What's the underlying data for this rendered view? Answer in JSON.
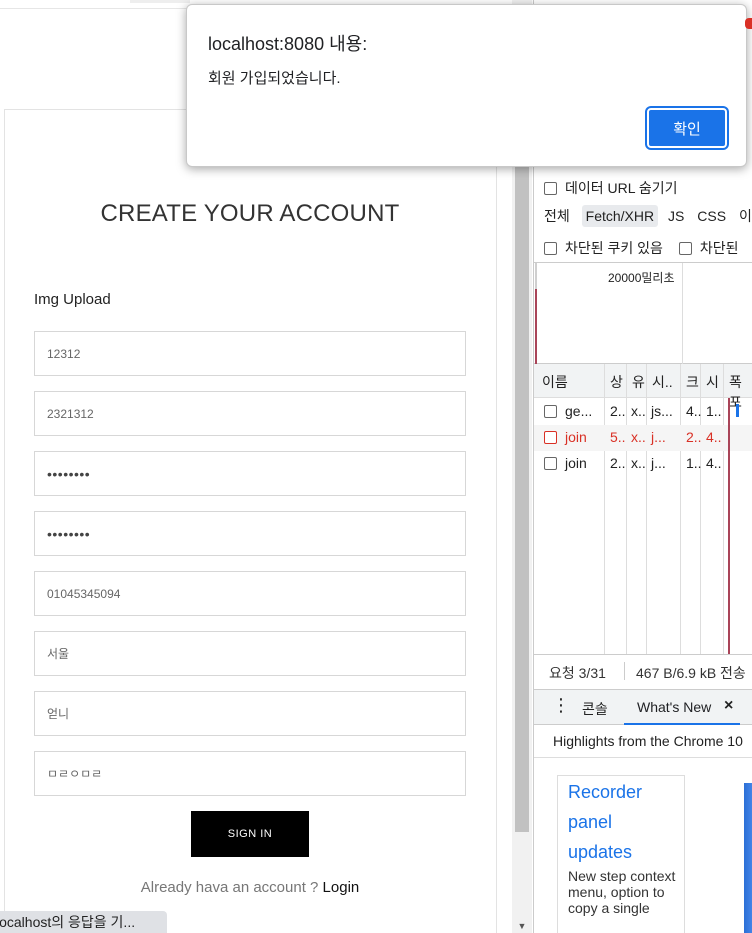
{
  "form": {
    "title": "CREATE YOUR ACCOUNT",
    "img_upload_label": "Img Upload",
    "fields": [
      {
        "value": "12312",
        "type": "text"
      },
      {
        "value": "2321312",
        "type": "text"
      },
      {
        "value": "••••••••",
        "type": "password"
      },
      {
        "value": "••••••••",
        "type": "password"
      },
      {
        "value": "01045345094",
        "type": "text"
      },
      {
        "value": "서울",
        "type": "text"
      },
      {
        "value": "얻니",
        "type": "text"
      },
      {
        "value": "ㅁㄹㅇㅁㄹ",
        "type": "text"
      }
    ],
    "signin_label": "SIGN IN",
    "already_text": "Already hava an account ? ",
    "login_label": "Login"
  },
  "statusbar": {
    "text": "localhost의 응답을 기..."
  },
  "alert": {
    "title": "localhost:8080 내용:",
    "message": "회원 가입되었습니다.",
    "ok_label": "확인"
  },
  "devtools": {
    "hide_data_url": "데이터 URL 숨기기",
    "filters": {
      "all": "전체",
      "fetch": "Fetch/XHR",
      "js": "JS",
      "css": "CSS",
      "more": "이"
    },
    "blocked_cookies": "차단된 쿠키 있음",
    "blocked_requests": "차단된",
    "timeline_label": "20000밀리초",
    "columns": [
      "이름",
      "상",
      "유",
      "시..",
      "크",
      "시",
      "폭포"
    ],
    "rows": [
      {
        "name": "ge...",
        "status": "2..",
        "type": "x..",
        "initiator": "js...",
        "size": "4..",
        "time": "1..",
        "error": false
      },
      {
        "name": "join",
        "status": "5..",
        "type": "x..",
        "initiator": "j...",
        "size": "2..",
        "time": "4..",
        "error": true
      },
      {
        "name": "join",
        "status": "2..",
        "type": "x..",
        "initiator": "j...",
        "size": "1..",
        "time": "4..",
        "error": false
      }
    ],
    "status_requests": "요청 3/31",
    "status_transfer": "467 B/6.9 kB 전송",
    "drawer": {
      "console": "콘솔",
      "whats_new": "What's New",
      "close": "×"
    },
    "highlights": "Highlights from the Chrome 10",
    "card": {
      "link_lines": [
        "Recorder",
        "panel",
        "updates"
      ],
      "body": "New step context menu, option to copy a single"
    }
  },
  "colors": {
    "accent": "#1a73e8",
    "error": "#d93025",
    "button_black": "#000000"
  }
}
